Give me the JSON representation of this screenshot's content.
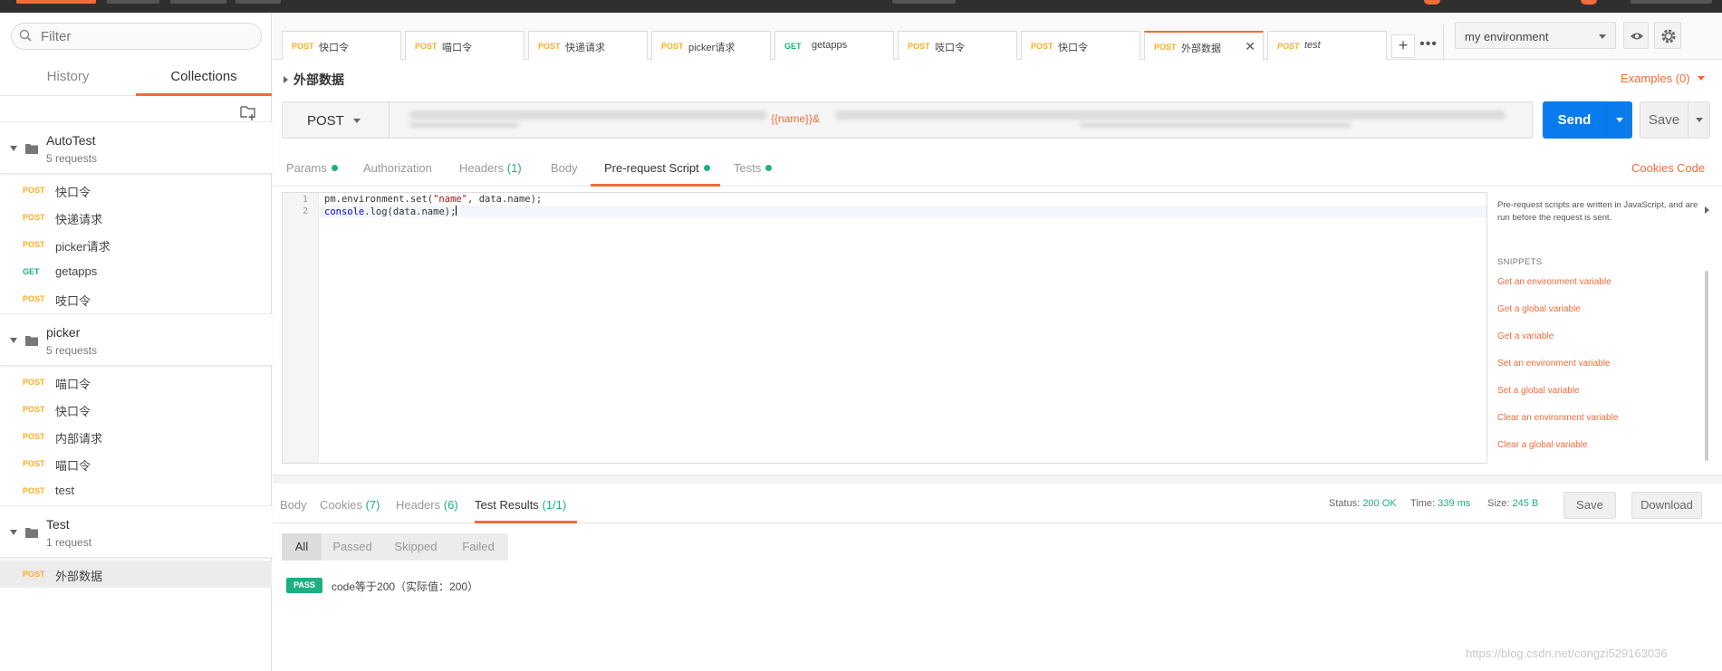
{
  "colors": {
    "accent": "#f26b3a",
    "post": "#ffad1f",
    "get": "#1cb082",
    "send": "#097bed",
    "success": "#1cb082"
  },
  "sidebar": {
    "filter_placeholder": "Filter",
    "tabs": [
      "History",
      "Collections"
    ],
    "active_tab": "Collections",
    "collections": [
      {
        "name": "AutoTest",
        "count": "5 requests",
        "requests": [
          {
            "method": "POST",
            "name": "快口令"
          },
          {
            "method": "POST",
            "name": "快递请求"
          },
          {
            "method": "POST",
            "name": "picker请求"
          },
          {
            "method": "GET",
            "name": "getapps"
          },
          {
            "method": "POST",
            "name": "吱口令"
          }
        ]
      },
      {
        "name": "picker",
        "count": "5 requests",
        "requests": [
          {
            "method": "POST",
            "name": "喵口令"
          },
          {
            "method": "POST",
            "name": "快口令"
          },
          {
            "method": "POST",
            "name": "内部请求"
          },
          {
            "method": "POST",
            "name": "喵口令"
          },
          {
            "method": "POST",
            "name": "test"
          }
        ]
      },
      {
        "name": "Test",
        "count": "1 request",
        "requests": [
          {
            "method": "POST",
            "name": "外部数据"
          }
        ]
      }
    ]
  },
  "tabs": [
    {
      "method": "POST",
      "name": "快口令"
    },
    {
      "method": "POST",
      "name": "喵口令"
    },
    {
      "method": "POST",
      "name": "快递请求"
    },
    {
      "method": "POST",
      "name": "picker请求"
    },
    {
      "method": "GET",
      "name": "getapps"
    },
    {
      "method": "POST",
      "name": "吱口令"
    },
    {
      "method": "POST",
      "name": "快口令"
    },
    {
      "method": "POST",
      "name": "外部数据"
    },
    {
      "method": "POST",
      "name": "test"
    }
  ],
  "tab_add": "+",
  "tab_more": "•••",
  "environment": "my environment",
  "request": {
    "name": "外部数据",
    "examples": "Examples (0)",
    "method": "POST",
    "url_variable": "{{name}}&",
    "send": "Send",
    "save": "Save"
  },
  "subtabs": {
    "params": "Params",
    "authorization": "Authorization",
    "headers": "Headers",
    "headers_count": "(1)",
    "body": "Body",
    "prerequest": "Pre-request Script",
    "tests": "Tests",
    "cookies": "Cookies",
    "code": "Code"
  },
  "editor": {
    "line1_no": "1",
    "line2_no": "2",
    "line1_a": "pm.environment.set(",
    "line1_str": "\"name\"",
    "line1_b": ", data.name);",
    "line2_kw": "console",
    "line2_b": ".log(data.name);"
  },
  "snippets": {
    "description": "Pre-request scripts are written in JavaScript, and are run before the request is sent.",
    "heading": "SNIPPETS",
    "items": [
      "Get an environment variable",
      "Get a global variable",
      "Get a variable",
      "Set an environment variable",
      "Set a global variable",
      "Clear an environment variable",
      "Clear a global variable"
    ]
  },
  "response": {
    "tab_body": "Body",
    "tab_cookies": "Cookies",
    "cookies_count": "(7)",
    "tab_headers": "Headers",
    "headers_count": "(6)",
    "tab_tests": "Test Results",
    "tests_count": "(1/1)",
    "status_label": "Status:",
    "status": "200 OK",
    "time_label": "Time:",
    "time": "339 ms",
    "size_label": "Size:",
    "size": "245 B",
    "save": "Save",
    "download": "Download"
  },
  "test_filters": [
    "All",
    "Passed",
    "Skipped",
    "Failed"
  ],
  "test_result": {
    "badge": "PASS",
    "name": "code等于200（实际值：200）"
  },
  "watermark": "https://blog.csdn.net/congzi529163036"
}
